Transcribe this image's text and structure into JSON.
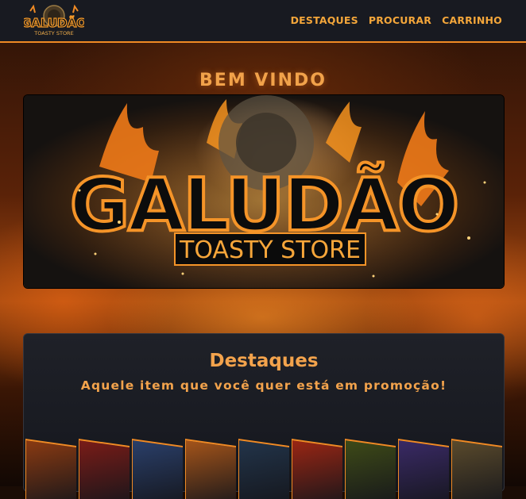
{
  "header": {
    "logo_alt": "Galudão Toasty Store logo",
    "nav": [
      {
        "label": "DESTAQUES"
      },
      {
        "label": "PROCURAR"
      },
      {
        "label": "CARRINHO"
      }
    ]
  },
  "hero": {
    "welcome": "BEM VINDO",
    "banner": {
      "title": "GALUDÃO",
      "subtitle": "TOASTY STORE"
    }
  },
  "featured": {
    "title": "Destaques",
    "subtitle": "Aquele item que você quer está em promoção!",
    "items": [
      {
        "icon": "hero-card-1",
        "color": "#8a3a12"
      },
      {
        "icon": "hero-card-2",
        "color": "#7a1c18"
      },
      {
        "icon": "hero-card-3",
        "color": "#2a3f6a"
      },
      {
        "icon": "hero-card-4",
        "color": "#a4541a"
      },
      {
        "icon": "hero-card-5",
        "color": "#22344a"
      },
      {
        "icon": "hero-card-6",
        "color": "#9a2614"
      },
      {
        "icon": "hero-card-7",
        "color": "#3e4a18"
      },
      {
        "icon": "hero-card-8",
        "color": "#3a2a66"
      },
      {
        "icon": "hero-card-9",
        "color": "#5a4a2c"
      }
    ]
  },
  "colors": {
    "accent": "#f08a24",
    "text_accent": "#f3a34c",
    "bar": "#181a21"
  }
}
